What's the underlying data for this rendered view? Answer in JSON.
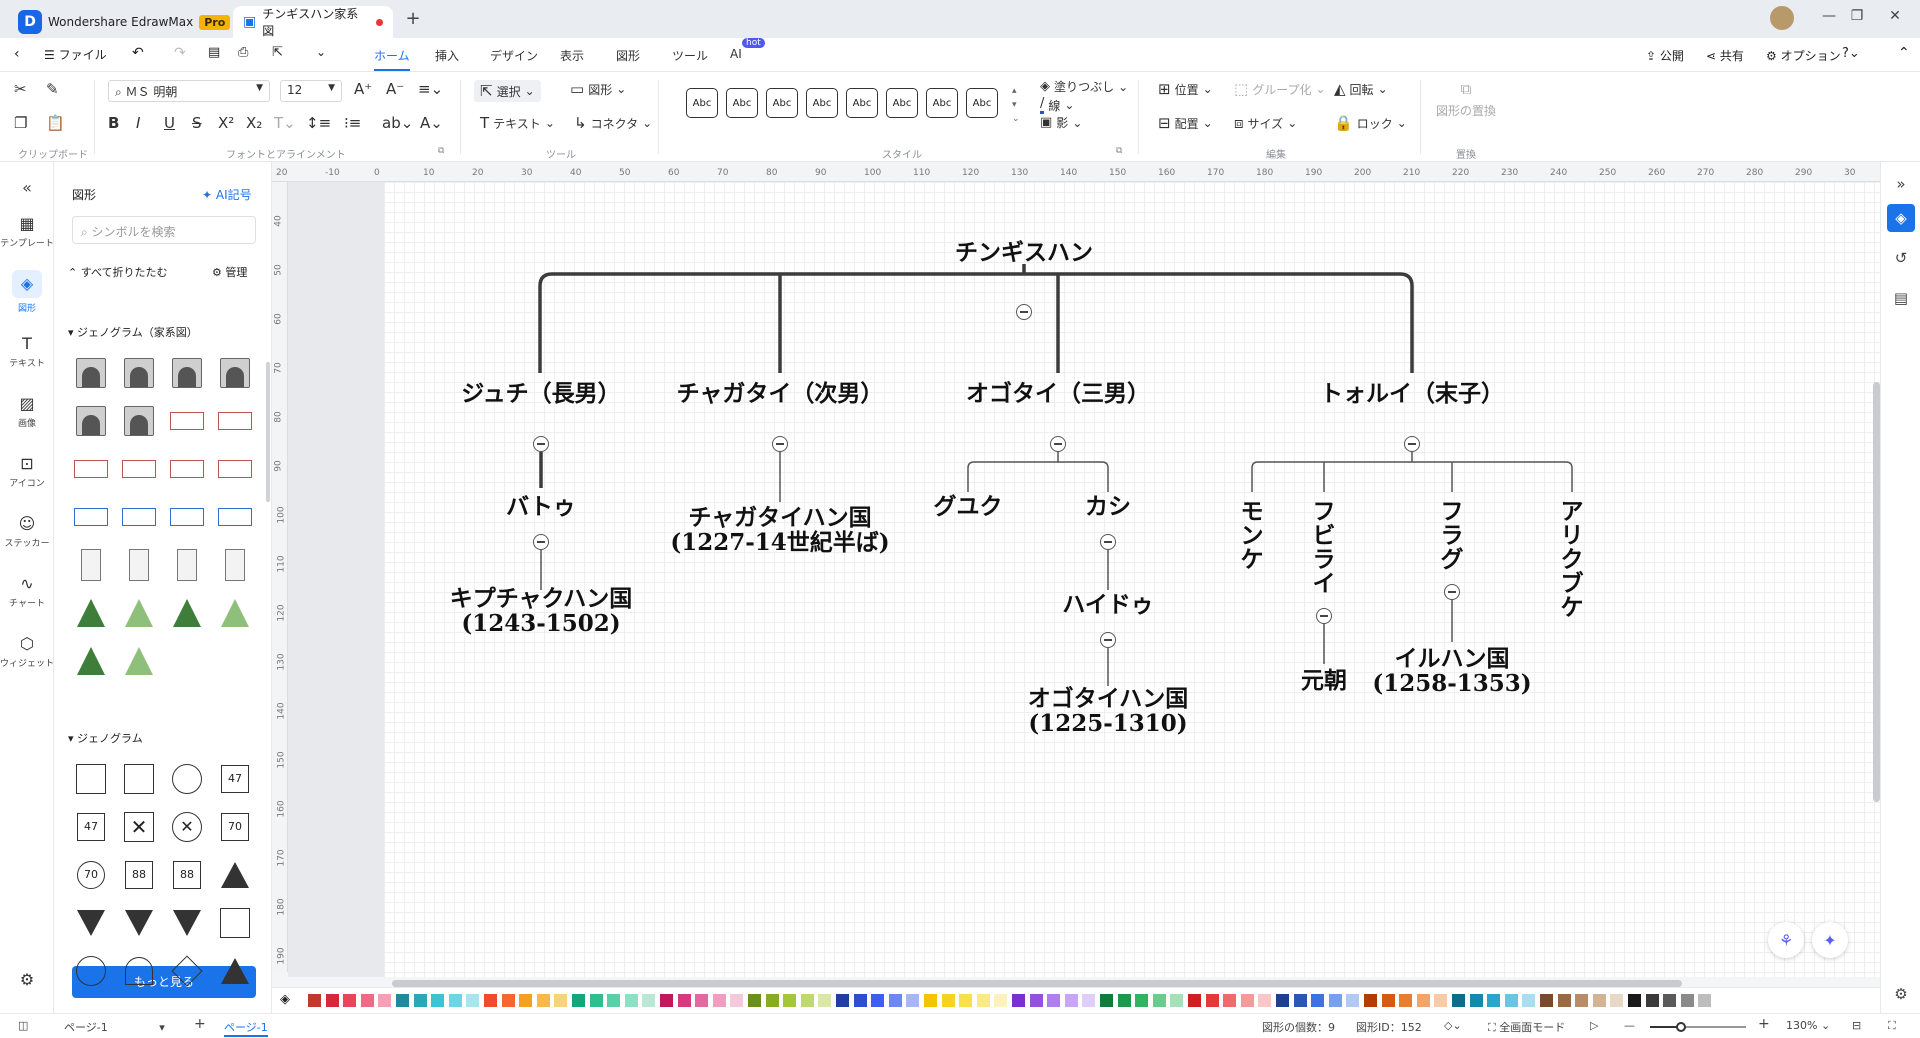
{
  "app": {
    "name": "Wondershare EdrawMax",
    "badge": "Pro"
  },
  "document_tab": {
    "title": "チンギスハン家系図"
  },
  "menu": {
    "file": "ファイル",
    "tabs": [
      "ホーム",
      "挿入",
      "デザイン",
      "表示",
      "図形",
      "ツール",
      "AI"
    ],
    "hot": "hot",
    "publish": "公開",
    "share": "共有",
    "options": "オプション"
  },
  "ribbon": {
    "font_name": "ＭＳ 明朝",
    "font_size": "12",
    "select": "選択",
    "shape": "図形",
    "text": "テキスト",
    "connector": "コネクタ",
    "fill": "塗りつぶし",
    "line": "線",
    "shadow": "影",
    "position": "位置",
    "align": "配置",
    "group": "グループ化",
    "size": "サイズ",
    "rotate": "回転",
    "lock": "ロック",
    "replace_shape": "図形の置換",
    "style_sample": "Abc",
    "groups": {
      "clipboard": "クリップボード",
      "font": "フォントとアラインメント",
      "tools": "ツール",
      "style": "スタイル",
      "edit": "編集",
      "replace": "置換"
    }
  },
  "leftbar": [
    {
      "label": "テンプレート",
      "icon": "template-icon"
    },
    {
      "label": "図形",
      "icon": "shapes-icon"
    },
    {
      "label": "テキスト",
      "icon": "text-icon"
    },
    {
      "label": "画像",
      "icon": "image-icon"
    },
    {
      "label": "アイコン",
      "icon": "icon-icon"
    },
    {
      "label": "ステッカー",
      "icon": "sticker-icon"
    },
    {
      "label": "チャート",
      "icon": "chart-icon"
    },
    {
      "label": "ウィジェット",
      "icon": "widget-icon"
    }
  ],
  "library": {
    "title": "図形",
    "ai_button": "AI記号",
    "search_placeholder": "シンボルを検索",
    "collapse_all": "すべて折りたたむ",
    "manage": "管理",
    "section1": "ジェノグラム（家系図）",
    "section2": "ジェノグラム",
    "more": "もっと見る",
    "genogram_numbers": [
      "47",
      "47",
      "70",
      "70",
      "88",
      "88"
    ]
  },
  "ruler": {
    "h": [
      "20",
      "-10",
      "0",
      "10",
      "20",
      "30",
      "40",
      "50",
      "60",
      "70",
      "80",
      "90",
      "100",
      "110",
      "120",
      "130",
      "140",
      "150",
      "160",
      "170",
      "180",
      "190",
      "200",
      "210",
      "220",
      "230",
      "240",
      "250",
      "260",
      "270",
      "280",
      "290",
      "30"
    ],
    "v": [
      "40",
      "50",
      "60",
      "70",
      "80",
      "90",
      "100",
      "110",
      "120",
      "130",
      "140",
      "150",
      "160",
      "170",
      "180",
      "190"
    ]
  },
  "tree": {
    "root": "チンギスハン",
    "sons": [
      "ジュチ（長男）",
      "チャガタイ（次男）",
      "オゴタイ（三男）",
      "トォルイ（末子）"
    ],
    "batu": "バトゥ",
    "kipchak": [
      "キプチャクハン国",
      "(1243-1502)"
    ],
    "chagatai_khanate": [
      "チャガタイハン国",
      "(1227-14世紀半ば)"
    ],
    "guyuk": "グユク",
    "kashi": "カシ",
    "haidu": "ハイドゥ",
    "ogedei_khanate": [
      "オゴタイハン国",
      "(1225-1310)"
    ],
    "mongke": "モンケ",
    "kublai": "フビライ",
    "hulagu": "フラグ",
    "ariq": "アリクブケ",
    "yuan": "元朝",
    "ilkhanate": [
      "イルハン国",
      "(1258-1353)"
    ]
  },
  "status": {
    "page_selector": "ページ-1",
    "page_tab": "ページ-1",
    "shape_count": "図形の個数：9",
    "shape_id": "図形ID：152",
    "fullscreen": "全画面モード",
    "zoom": "130%"
  },
  "palette": [
    "#c0392b",
    "#d62839",
    "#e8455a",
    "#f06a85",
    "#f5a0b4",
    "#1f8a9c",
    "#2aa8b8",
    "#3bc2d4",
    "#6dd6e4",
    "#a8e6ef",
    "#f04b2d",
    "#f5682d",
    "#f6a023",
    "#f8b84a",
    "#f9d27c",
    "#12a77a",
    "#2fbf8f",
    "#58d1a8",
    "#8de0c3",
    "#b9e9d5",
    "#c2185b",
    "#d63a7d",
    "#e668a0",
    "#f09dc1",
    "#f6c8dc",
    "#6a8f1a",
    "#86ac24",
    "#a4c639",
    "#c0d96e",
    "#dae8a6",
    "#1f3fa6",
    "#2c4fd0",
    "#3c5ff0",
    "#6d88f5",
    "#a7b6f8",
    "#f5c400",
    "#f7d21f",
    "#fae04e",
    "#fbe986",
    "#fdf2bb",
    "#7b2fd0",
    "#9650e0",
    "#b17ef0",
    "#c8a6f5",
    "#e0cdf9",
    "#0e7c3a",
    "#1a9a4a",
    "#2fb560",
    "#6acb8b",
    "#a6e0b8",
    "#d01f1f",
    "#e53935",
    "#f06a6a",
    "#f59a9a",
    "#f9c7c7",
    "#1d3f8f",
    "#2a56b8",
    "#3d72e0",
    "#77a0ee",
    "#b3c9f5",
    "#b33c00",
    "#d65a10",
    "#eb7d2e",
    "#f3a46a",
    "#f8caa6",
    "#0a6d8a",
    "#1289ad",
    "#2aa5cc",
    "#6bc4e0",
    "#a9def0",
    "#7b4a2a",
    "#9c6a42",
    "#b88c66",
    "#d2b494",
    "#e8d8c6",
    "#1a1a1a",
    "#3a3a3a",
    "#5a5a5a",
    "#8a8a8a",
    "#bdbdbd"
  ]
}
